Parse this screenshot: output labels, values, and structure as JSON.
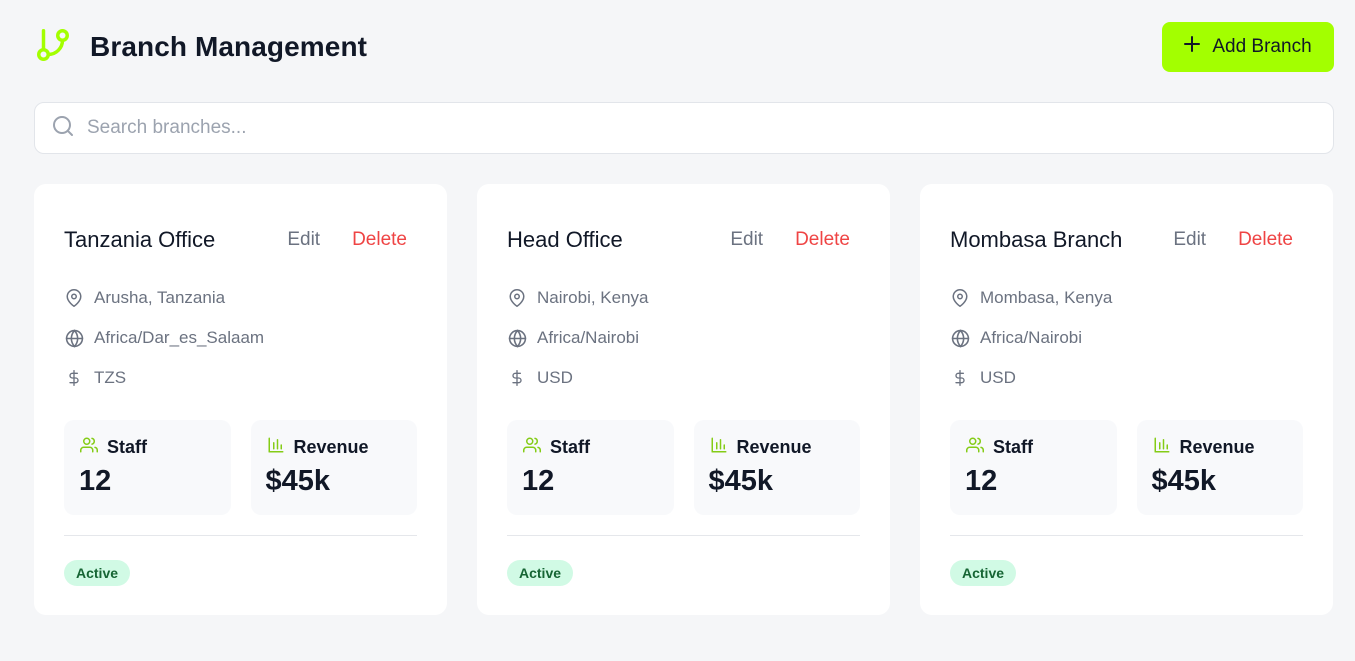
{
  "header": {
    "title": "Branch Management",
    "add_button_label": "Add Branch",
    "logo_icon": "git-branch-icon"
  },
  "search": {
    "placeholder": "Search branches...",
    "value": ""
  },
  "colors": {
    "accent": "#a3ff00",
    "danger": "#ef4444",
    "badge_bg": "#d1fae5",
    "badge_text": "#166534"
  },
  "branches": [
    {
      "name": "Tanzania Office",
      "edit_label": "Edit",
      "delete_label": "Delete",
      "location": "Arusha, Tanzania",
      "timezone": "Africa/Dar_es_Salaam",
      "currency": "TZS",
      "staff_label": "Staff",
      "staff_value": "12",
      "revenue_label": "Revenue",
      "revenue_value": "$45k",
      "status": "Active"
    },
    {
      "name": "Head Office",
      "edit_label": "Edit",
      "delete_label": "Delete",
      "location": "Nairobi, Kenya",
      "timezone": "Africa/Nairobi",
      "currency": "USD",
      "staff_label": "Staff",
      "staff_value": "12",
      "revenue_label": "Revenue",
      "revenue_value": "$45k",
      "status": "Active"
    },
    {
      "name": "Mombasa Branch",
      "edit_label": "Edit",
      "delete_label": "Delete",
      "location": "Mombasa, Kenya",
      "timezone": "Africa/Nairobi",
      "currency": "USD",
      "staff_label": "Staff",
      "staff_value": "12",
      "revenue_label": "Revenue",
      "revenue_value": "$45k",
      "status": "Active"
    }
  ]
}
